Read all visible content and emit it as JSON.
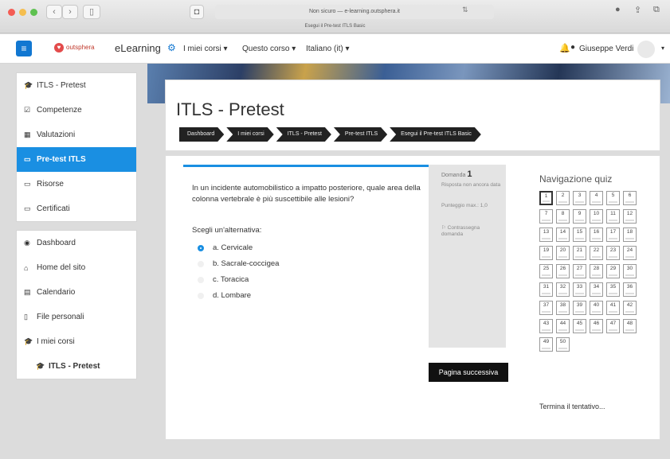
{
  "browser": {
    "url": "Non sicuro — e-learning.outsphera.it",
    "tab_title": "Esegui il Pre-test ITLS Basic"
  },
  "navbar": {
    "hamburger_icon": "≡",
    "logo_text": "outsphera",
    "brand": "eLearning",
    "gear_icon": "⚙",
    "menus": [
      "I miei corsi ▾",
      "Questo corso ▾",
      "Italiano (it) ▾"
    ],
    "user_name": "Giuseppe Verdi"
  },
  "sidebar": {
    "group1": [
      {
        "icon": "🎓",
        "label": "ITLS - Pretest"
      },
      {
        "icon": "☑",
        "label": "Competenze"
      },
      {
        "icon": "▦",
        "label": "Valutazioni"
      },
      {
        "icon": "▭",
        "label": "Pre-test ITLS",
        "active": true
      },
      {
        "icon": "▭",
        "label": "Risorse"
      },
      {
        "icon": "▭",
        "label": "Certificati"
      }
    ],
    "group2": [
      {
        "icon": "◉",
        "label": "Dashboard"
      },
      {
        "icon": "⌂",
        "label": "Home del sito"
      },
      {
        "icon": "▤",
        "label": "Calendario"
      },
      {
        "icon": "▯",
        "label": "File personali"
      },
      {
        "icon": "🎓",
        "label": "I miei corsi"
      },
      {
        "icon": "🎓",
        "label": "ITLS - Pretest",
        "sub": true
      }
    ]
  },
  "header": {
    "title": "ITLS - Pretest",
    "breadcrumbs": [
      "Dashboard",
      "I miei corsi",
      "ITLS - Pretest",
      "Pre-test ITLS",
      "Esegui il Pre-test ITLS Basic"
    ]
  },
  "question": {
    "text": "In un incidente automobilistico a impatto posteriore, quale area della colonna vertebrale è più suscettibile alle lesioni?",
    "prompt": "Scegli un'alternativa:",
    "options": [
      "a. Cervicale",
      "b. Sacrale-coccigea",
      "c. Toracica",
      "d. Lombare"
    ],
    "selected_index": 0,
    "info": {
      "label": "Domanda",
      "number": "1",
      "status": "Risposta non ancora data",
      "score": "Punteggio max.: 1,0",
      "flag": "Contrassegna domanda"
    },
    "next_button": "Pagina successiva"
  },
  "quiz_nav": {
    "title": "Navigazione quiz",
    "numbers": [
      "1",
      "2",
      "3",
      "4",
      "5",
      "6",
      "7",
      "8",
      "9",
      "10",
      "11",
      "12",
      "13",
      "14",
      "15",
      "16",
      "17",
      "18",
      "19",
      "20",
      "21",
      "22",
      "23",
      "24",
      "25",
      "26",
      "27",
      "28",
      "29",
      "30",
      "31",
      "32",
      "33",
      "34",
      "35",
      "36",
      "37",
      "38",
      "39",
      "40",
      "41",
      "42",
      "43",
      "44",
      "45",
      "46",
      "47",
      "48",
      "49",
      "50"
    ],
    "current": "1",
    "finish": "Termina il tentativo..."
  }
}
